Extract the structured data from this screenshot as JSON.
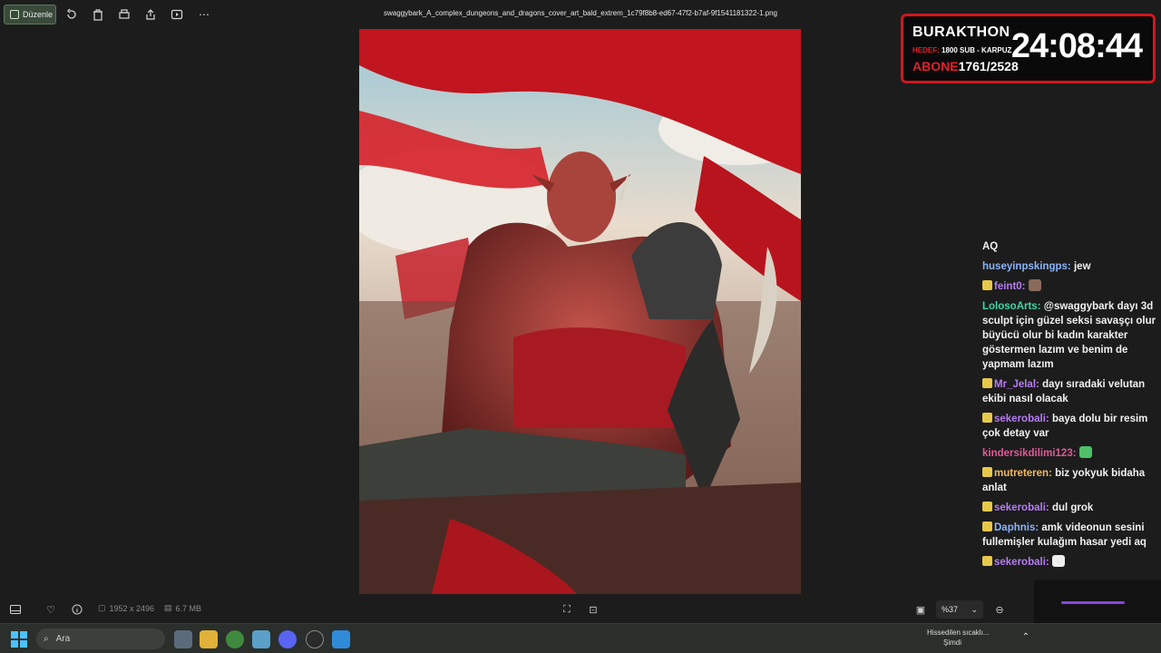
{
  "toolbar": {
    "edit_label": "Düzenle",
    "filename": "swaggybark_A_complex_dungeons_and_dragons_cover_art_bald_extrem_1c79f8b8-ed67-47f2-b7af-9f1541181322-1.png"
  },
  "overlay": {
    "title": "BURAKTHON",
    "target_prefix": "HEDEF:",
    "target_text": "1800 SUB - KARPUZ",
    "sub_prefix": "ABONE",
    "sub_count": "1761/2528",
    "timer": "24:08:44"
  },
  "chat": [
    {
      "user": "",
      "text": "AQ",
      "user_color": "#ffffff"
    },
    {
      "user": "huseyinpskingps:",
      "text": "jew",
      "user_color": "#8ab4f8"
    },
    {
      "user": "feint0:",
      "text": "",
      "user_color": "#b57cf2",
      "badge": true,
      "emote": "#8a6b5a"
    },
    {
      "user": "LolosoArts:",
      "text": "@swaggybark dayı 3d sculpt için güzel seksi savaşçı olur büyücü olur bi kadın karakter göstermen lazım ve benim de yapmam lazım",
      "user_color": "#3fd6a5"
    },
    {
      "user": "Mr_Jelal:",
      "text": "dayı sıradaki velutan ekibi nasıl olacak",
      "user_color": "#b57cf2",
      "badge": true
    },
    {
      "user": "sekerobali:",
      "text": "baya dolu bir resim çok detay var",
      "user_color": "#b57cf2",
      "badge": true
    },
    {
      "user": "kindersikdilimi123:",
      "text": "",
      "user_color": "#e05a9a",
      "emote": "#4fbf6a"
    },
    {
      "user": "mutreteren:",
      "text": "biz yokyuk bidaha anlat",
      "user_color": "#f0b860",
      "badge": true
    },
    {
      "user": "sekerobali:",
      "text": "dul grok",
      "user_color": "#b57cf2",
      "badge": true
    },
    {
      "user": "Daphnis:",
      "text": "amk videonun sesini fullemişler kulağım hasar yedi aq",
      "user_color": "#8ab4f8",
      "badge": true
    },
    {
      "user": "sekerobali:",
      "text": "",
      "user_color": "#b57cf2",
      "badge": true,
      "emote": "#eeeeee"
    }
  ],
  "statusbar": {
    "dimensions": "1952 x 2496",
    "filesize": "6.7 MB",
    "zoom": "%37"
  },
  "taskbar": {
    "search_placeholder": "Ara",
    "weather_line1": "Hissedilen sıcaklı...",
    "weather_line2": "Şimdi"
  }
}
